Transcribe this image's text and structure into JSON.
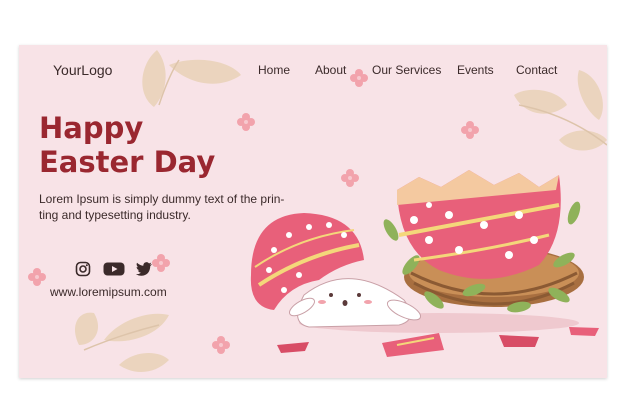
{
  "header": {
    "logo": "YourLogo",
    "nav": [
      "Home",
      "About",
      "Our Services",
      "Events",
      "Contact"
    ]
  },
  "hero": {
    "title_line1": "Happy",
    "title_line2": "Easter Day",
    "description_line1": "Lorem Ipsum is simply dummy text of the prin-",
    "description_line2": "ting and typesetting industry."
  },
  "social": {
    "icons": [
      "instagram-icon",
      "youtube-icon",
      "twitter-icon"
    ],
    "website": "www.loremipsum.com"
  },
  "colors": {
    "background": "#f8e3e7",
    "title": "#9a2730",
    "egg_pink": "#e8607a",
    "basket": "#b07a4b"
  }
}
